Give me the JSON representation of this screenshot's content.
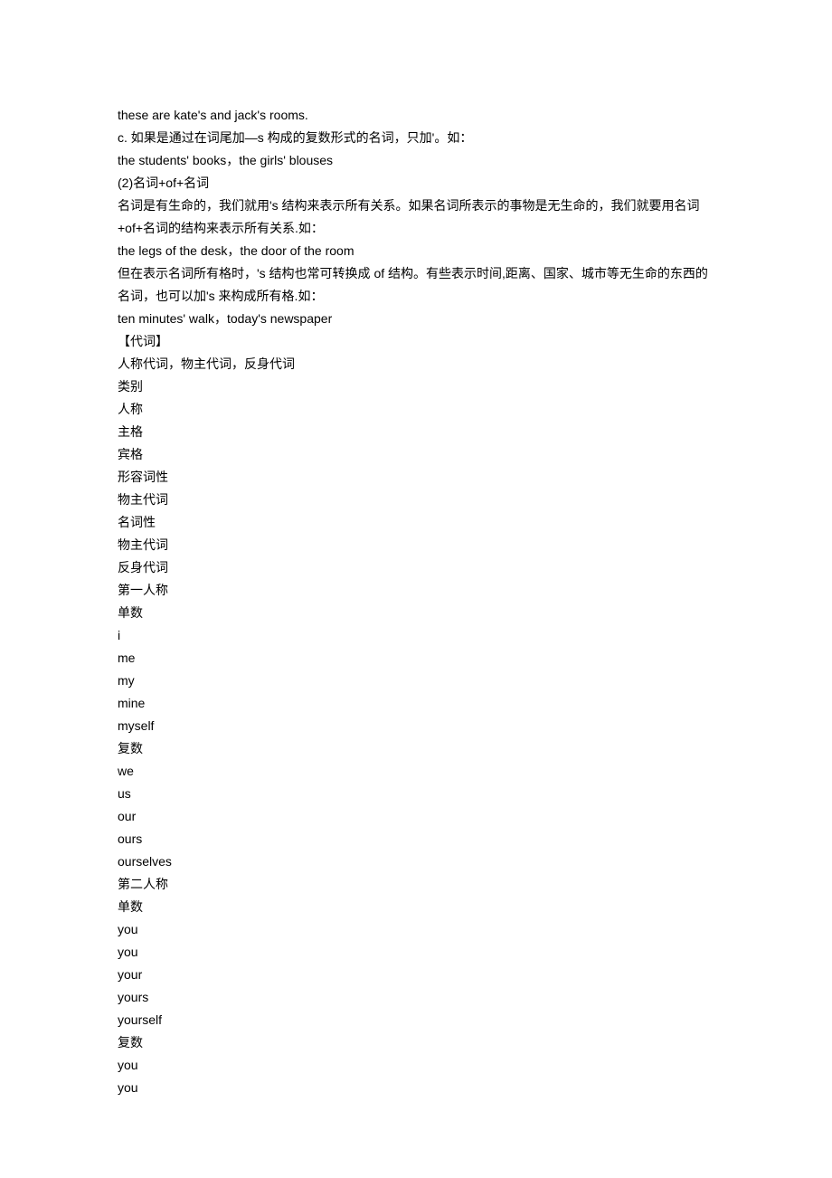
{
  "lines": [
    "these are kate's and jack's rooms.",
    "c. 如果是通过在词尾加—s 构成的复数形式的名词，只加'。如：",
    "the students' books，the girls' blouses",
    "(2)名词+of+名词",
    "名词是有生命的，我们就用's 结构来表示所有关系。如果名词所表示的事物是无生命的，我们就要用名词+of+名词的结构来表示所有关系.如：",
    "the legs of the desk，the door of the room",
    "但在表示名词所有格时，'s 结构也常可转换成 of 结构。有些表示时间,距离、国家、城市等无生命的东西的名词，也可以加's 来构成所有格.如：",
    "ten minutes' walk，today's newspaper",
    "【代词】",
    "人称代词，物主代词，反身代词",
    "类别",
    "人称",
    "主格",
    "宾格",
    "形容词性",
    "物主代词",
    "名词性",
    "物主代词",
    "反身代词",
    "第一人称",
    "单数",
    "i",
    "me",
    "my",
    "mine",
    "myself",
    "复数",
    "we",
    "us",
    "our",
    "ours",
    "ourselves",
    "第二人称",
    "单数",
    "you",
    "you",
    "your",
    "yours",
    "yourself",
    "复数",
    "you",
    "you"
  ]
}
